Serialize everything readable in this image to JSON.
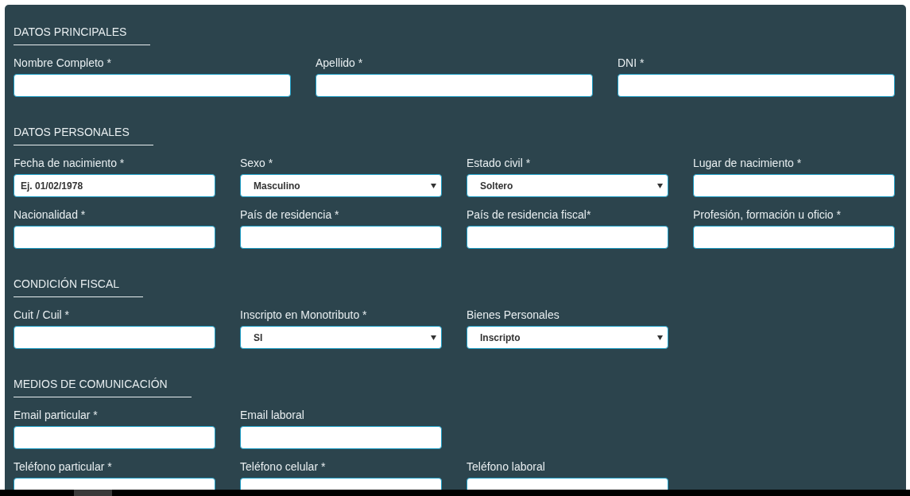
{
  "sections": [
    {
      "title": "DATOS PRINCIPALES",
      "fields": [
        {
          "kind": "text",
          "label": "Nombre Completo *"
        },
        {
          "kind": "text",
          "label": "Apellido *"
        },
        {
          "kind": "text",
          "label": "DNI *"
        }
      ]
    },
    {
      "title": "DATOS PERSONALES",
      "fields": [
        {
          "kind": "text",
          "label": "Fecha de nacimiento *",
          "placeholder": "Ej. 01/02/1978"
        },
        {
          "kind": "select",
          "label": "Sexo *",
          "value": "Masculino"
        },
        {
          "kind": "select",
          "label": "Estado civil *",
          "value": "Soltero"
        },
        {
          "kind": "text",
          "label": "Lugar de nacimiento *"
        },
        {
          "kind": "text",
          "label": "Nacionalidad *"
        },
        {
          "kind": "text",
          "label": "País de residencia *"
        },
        {
          "kind": "text",
          "label": "País de residencia fiscal*"
        },
        {
          "kind": "text",
          "label": "Profesión, formación u oficio *"
        }
      ]
    },
    {
      "title": "CONDICIÓN FISCAL",
      "fields": [
        {
          "kind": "text",
          "label": "Cuit / Cuil *"
        },
        {
          "kind": "select",
          "label": "Inscripto en Monotributo *",
          "value": "SI"
        },
        {
          "kind": "select",
          "label": "Bienes Personales",
          "value": "Inscripto"
        }
      ]
    },
    {
      "title": "MEDIOS DE COMUNICACIÓN",
      "fields": [
        {
          "kind": "text",
          "label": "Email particular *"
        },
        {
          "kind": "text",
          "label": "Email laboral"
        },
        {
          "kind": "break"
        },
        {
          "kind": "text",
          "label": "Teléfono particular *"
        },
        {
          "kind": "text",
          "label": "Teléfono celular *"
        },
        {
          "kind": "text",
          "label": "Teléfono laboral"
        }
      ]
    }
  ]
}
